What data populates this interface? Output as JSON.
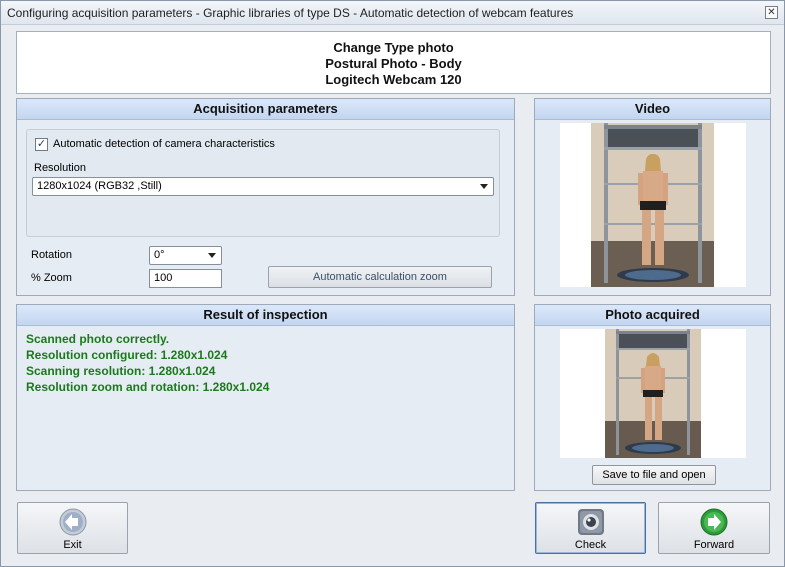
{
  "window": {
    "title": "Configuring acquisition parameters - Graphic libraries of type DS - Automatic detection of webcam features",
    "close_glyph": "✕"
  },
  "header": {
    "line1": "Change Type photo",
    "line2": "Postural Photo - Body",
    "line3": "Logitech Webcam 120"
  },
  "acquisition": {
    "title": "Acquisition parameters",
    "auto_detect_label": "Automatic detection of camera characteristics",
    "auto_detect_checked": true,
    "check_glyph": "✓",
    "resolution_label": "Resolution",
    "resolution_value": "1280x1024  (RGB32 ,Still)",
    "rotation_label": "Rotation",
    "rotation_value": "0°",
    "zoom_label": "% Zoom",
    "zoom_value": "100",
    "calc_zoom_button": "Automatic calculation zoom"
  },
  "video": {
    "title": "Video",
    "image": "postural-person-standing"
  },
  "result": {
    "title": "Result of inspection",
    "lines": [
      "Scanned photo correctly.",
      "Resolution configured: 1.280x1.024",
      "Scanning resolution: 1.280x1.024",
      "Resolution zoom and rotation: 1.280x1.024"
    ],
    "color": "#1b7a1b"
  },
  "acquired": {
    "title": "Photo acquired",
    "image": "postural-person-standing",
    "save_button": "Save to file and open"
  },
  "buttons": {
    "exit": {
      "label": "Exit",
      "icon": "back-arrow-icon"
    },
    "check": {
      "label": "Check",
      "icon": "webcam-icon"
    },
    "forward": {
      "label": "Forward",
      "icon": "forward-arrow-icon"
    }
  }
}
